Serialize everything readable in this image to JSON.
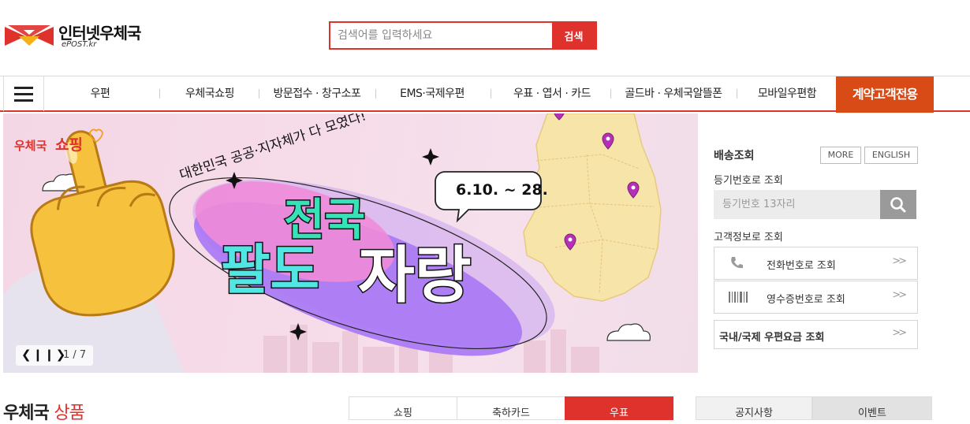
{
  "header": {
    "logo_title": "인터넷우체국",
    "logo_sub": "ePOST.kr",
    "search_placeholder": "검색어를 입력하세요",
    "search_button": "검색"
  },
  "nav": {
    "items": [
      "우편",
      "우체국쇼핑",
      "방문접수 · 창구소포",
      "EMS·국제우편",
      "우표 · 엽서 · 카드",
      "골드바 · 우체국알뜰폰",
      "모바일우편함"
    ],
    "special": "계약고객전용"
  },
  "banner": {
    "brand_line1": "우체국",
    "brand_line2": "쇼핑",
    "subtitle": "대한민국 공공·지자체가 다 모였다!",
    "date": "6.10. ~ 28.",
    "headline_top": "전국",
    "headline_a": "팔도",
    "headline_b": "자랑",
    "pager": "1 / 7",
    "colors": {
      "accent": "#e0322d",
      "headline_green": "#34e3b8",
      "headline_cyan": "#52e6e2",
      "purple": "#9d6cf2"
    }
  },
  "panel": {
    "title": "배송조회",
    "more": "MORE",
    "english": "ENGLISH",
    "reg_label": "등기번호로 조회",
    "reg_placeholder": "등기번호 13자리",
    "customer_label": "고객정보로 조회",
    "phone_link": "전화번호로 조회",
    "receipt_link": "영수증번호로 조회",
    "rate_link": "국내/국제 우편요금 조회"
  },
  "bottom": {
    "title_black": "우체국",
    "title_red": "상품",
    "tabs": [
      "쇼핑",
      "축하카드",
      "우표"
    ],
    "right_tabs": [
      "공지사항",
      "이벤트"
    ]
  }
}
